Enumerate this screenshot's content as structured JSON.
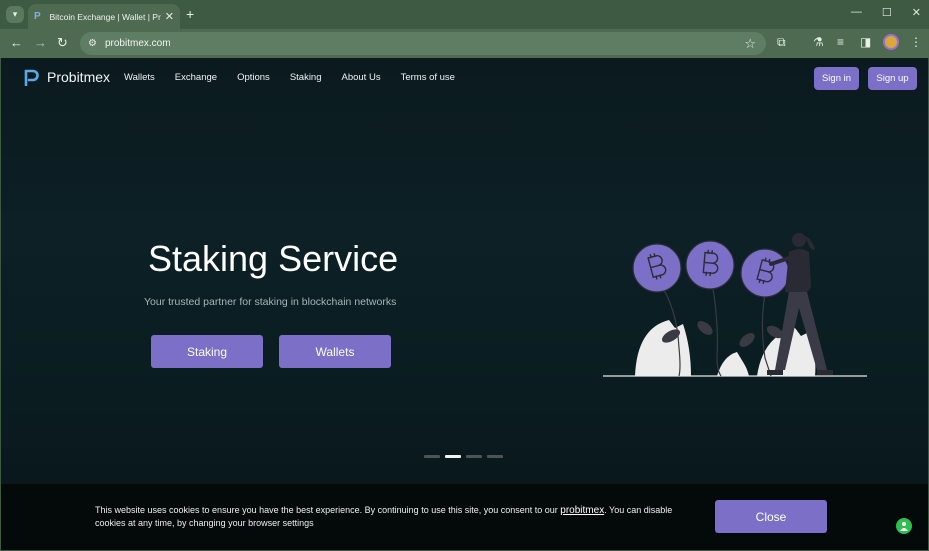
{
  "browser": {
    "tab_title": "Bitcoin Exchange | Wallet | Pro",
    "url": "probitmex.com"
  },
  "site": {
    "brand": "Probitmex",
    "nav": [
      "Wallets",
      "Exchange",
      "Options",
      "Staking",
      "About Us",
      "Terms of use"
    ],
    "sign_in": "Sign in",
    "sign_up": "Sign up"
  },
  "hero": {
    "title": "Staking Service",
    "subtitle": "Your trusted partner for staking in blockchain networks",
    "buttons": [
      "Staking",
      "Wallets"
    ],
    "slide_count": 4,
    "active_slide": 1
  },
  "cookie": {
    "text_before": "This website uses cookies to ensure you have the best experience. By continuing to use this site, you consent to our ",
    "link": "probitmex",
    "text_after": ". You can disable cookies at any time, by changing your browser settings",
    "close": "Close"
  },
  "colors": {
    "accent": "#7b6fc7",
    "chrome": "#4e6b52",
    "page_bg": "#0c2026"
  },
  "icons": [
    "tab-search-icon",
    "favicon-icon",
    "close-icon",
    "plus-icon",
    "back-icon",
    "forward-icon",
    "reload-icon",
    "site-info-icon",
    "star-icon",
    "extensions-icon",
    "labs-icon",
    "media-icon",
    "sidebar-icon",
    "menu-icon",
    "help-icon"
  ]
}
